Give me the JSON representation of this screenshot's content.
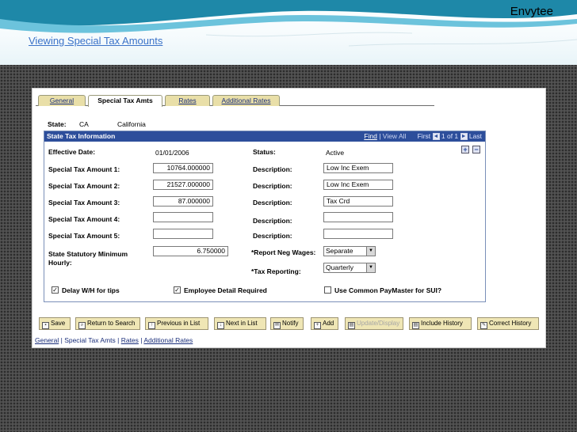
{
  "slide": {
    "brand": "Envytee",
    "title": "Viewing Special Tax Amounts"
  },
  "tabs": [
    {
      "label": "General",
      "active": false
    },
    {
      "label": "Special Tax Amts",
      "active": true
    },
    {
      "label": "Rates",
      "active": false
    },
    {
      "label": "Additional Rates",
      "active": false
    }
  ],
  "state": {
    "label": "State:",
    "code": "CA",
    "name": "California"
  },
  "grid": {
    "title": "State Tax Information",
    "find": "Find",
    "view_all": "View All",
    "first": "First",
    "count": "1 of 1",
    "last": "Last",
    "prev_glyph": "◄",
    "next_glyph": "►",
    "add_glyph": "+",
    "remove_glyph": "−"
  },
  "fields": {
    "effective_date_label": "Effective Date:",
    "effective_date": "01/01/2006",
    "status_label": "Status:",
    "status": "Active",
    "amount1_label": "Special Tax Amount 1:",
    "amount1": "10764.000000",
    "amount2_label": "Special Tax Amount 2:",
    "amount2": "21527.000000",
    "amount3_label": "Special Tax Amount 3:",
    "amount3": "87.000000",
    "amount4_label": "Special Tax Amount 4:",
    "amount4": "",
    "amount5_label": "Special Tax Amount 5:",
    "amount5": "",
    "desc_label": "Description:",
    "desc1": "Low Inc Exem",
    "desc2": "Low Inc Exem",
    "desc3": "Tax Crd",
    "desc4": "",
    "desc5": "",
    "statutory_label": "State Statutory Minimum Hourly:",
    "statutory_value": "6.750000",
    "neg_wages_label": "*Report Neg Wages:",
    "neg_wages": "Separate",
    "tax_reporting_label": "*Tax Reporting:",
    "tax_reporting": "Quarterly"
  },
  "checkboxes": {
    "delay_label": "Delay W/H for tips",
    "delay_checked": true,
    "detail_label": "Employee Detail Required",
    "detail_checked": true,
    "paymaster_label": "Use Common PayMaster for SUI?",
    "paymaster_checked": false,
    "check_glyph": "✓"
  },
  "toolbar": {
    "save": "Save",
    "return_search": "Return to Search",
    "prev_list": "Previous in List",
    "next_list": "Next in List",
    "notify": "Notify",
    "add": "Add",
    "update_display": "Update/Display",
    "include_history": "Include History",
    "correct_history": "Correct History"
  },
  "bottom_links": {
    "general": "General",
    "special": "Special Tax Amts",
    "rates": "Rates",
    "additional": "Additional Rates",
    "sep": " | "
  },
  "colors": {
    "grid_header": "#2d4e9b",
    "tab": "#e9dfa8",
    "button": "#efe6b5",
    "title_link": "#3a72c8"
  }
}
